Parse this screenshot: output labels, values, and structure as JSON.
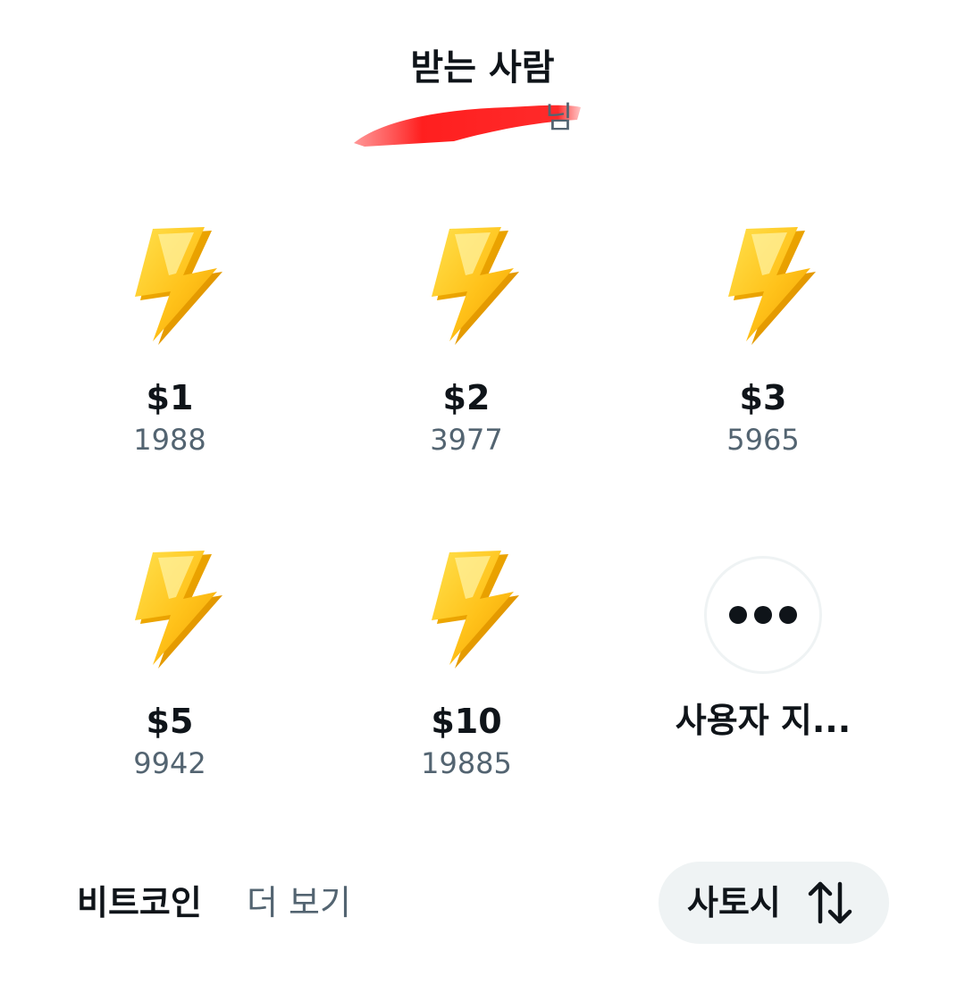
{
  "header": {
    "title": "받는 사람",
    "recipient_suffix": "님"
  },
  "tips": [
    {
      "amount": "$1",
      "sats": "1988",
      "icon": "lightning-bolt-icon"
    },
    {
      "amount": "$2",
      "sats": "3977",
      "icon": "lightning-bolt-icon"
    },
    {
      "amount": "$3",
      "sats": "5965",
      "icon": "lightning-bolt-icon"
    },
    {
      "amount": "$5",
      "sats": "9942",
      "icon": "lightning-bolt-icon"
    },
    {
      "amount": "$10",
      "sats": "19885",
      "icon": "lightning-bolt-icon"
    }
  ],
  "custom": {
    "label": "사용자 지...",
    "icon": "more-dots-icon"
  },
  "footer": {
    "currency": "비트코인",
    "more": "더 보기",
    "unit": "사토시",
    "unit_icon": "swap-arrows-icon"
  },
  "colors": {
    "text": "#0f1419",
    "secondary": "#536471",
    "toggle_bg": "#eff3f4",
    "redaction": "#ff2a2a"
  }
}
